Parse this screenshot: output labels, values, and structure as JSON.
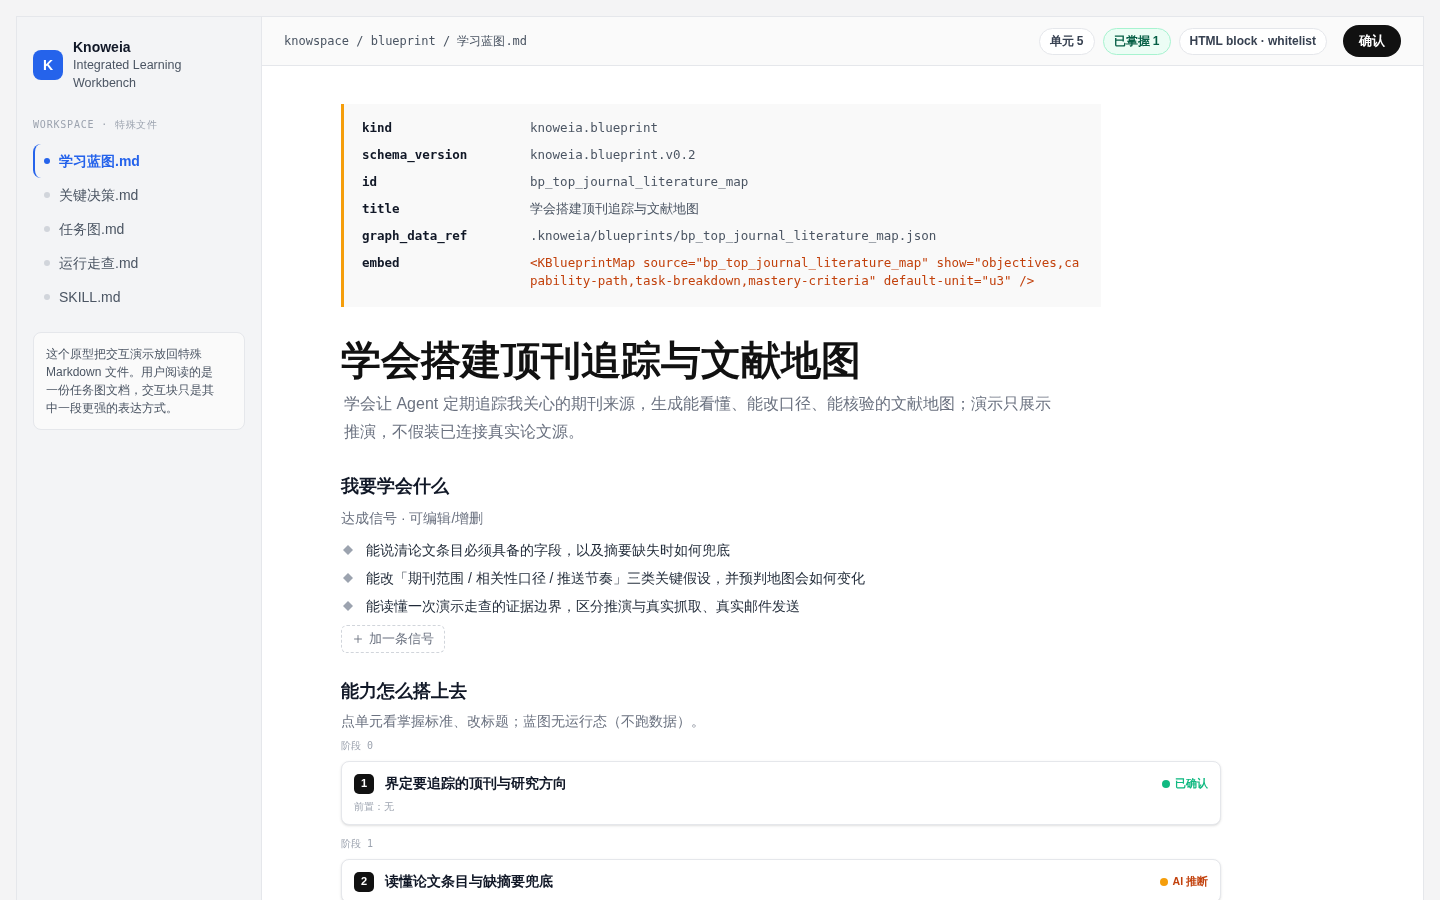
{
  "sidebar": {
    "brand": {
      "logo_letter": "K",
      "name": "Knoweia",
      "tagline": "Integrated Learning Workbench"
    },
    "section_label": "WORKSPACE · 特殊文件",
    "items": [
      {
        "label": "学习蓝图.md",
        "selected": true
      },
      {
        "label": "关键决策.md",
        "selected": false
      },
      {
        "label": "任务图.md",
        "selected": false
      },
      {
        "label": "运行走查.md",
        "selected": false
      },
      {
        "label": "SKILL.md",
        "selected": false
      }
    ],
    "note": "这个原型把交互演示放回特殊 Markdown 文件。用户阅读的是一份任务图文档，交互块只是其中一段更强的表达方式。"
  },
  "header": {
    "breadcrumb": "knowspace / blueprint / 学习蓝图.md",
    "badges": [
      {
        "label": "单元 5",
        "kind": "neutral"
      },
      {
        "label": "已掌握 1",
        "kind": "success"
      },
      {
        "label": "HTML block · whitelist",
        "kind": "neutral"
      }
    ],
    "confirm_button": "确认"
  },
  "frontmatter": {
    "fields": [
      {
        "key": "kind",
        "value": "knoweia.blueprint",
        "kind": "plain"
      },
      {
        "key": "schema_version",
        "value": "knoweia.blueprint.v0.2",
        "kind": "plain"
      },
      {
        "key": "id",
        "value": "bp_top_journal_literature_map",
        "kind": "plain"
      },
      {
        "key": "title",
        "value": "学会搭建顶刊追踪与文献地图",
        "kind": "plain"
      },
      {
        "key": "graph_data_ref",
        "value": ".knoweia/blueprints/bp_top_journal_literature_map.json",
        "kind": "plain"
      },
      {
        "key": "embed",
        "value": "<KBlueprintMap source=\"bp_top_journal_literature_map\" show=\"objectives,capability-path,task-breakdown,mastery-criteria\" default-unit=\"u3\" />",
        "kind": "code"
      }
    ]
  },
  "document": {
    "title": "学会搭建顶刊追踪与文献地图",
    "subtitle": "学会让 Agent 定期追踪我关心的期刊来源，生成能看懂、能改口径、能核验的文献地图；演示只展示推演，不假装已连接真实论文源。",
    "objectives": {
      "heading": "我要学会什么",
      "caption": "达成信号 · 可编辑/增删",
      "signals": [
        "能说清论文条目必须具备的字段，以及摘要缺失时如何兜底",
        "能改「期刊范围 / 相关性口径 / 推送节奏」三类关键假设，并预判地图会如何变化",
        "能读懂一次演示走查的证据边界，区分推演与真实抓取、真实邮件发送"
      ],
      "add_button": "加一条信号"
    },
    "capability_path": {
      "heading": "能力怎么搭上去",
      "caption": "点单元看掌握标准、改标题；蓝图无运行态（不跑数据）。",
      "stages": [
        {
          "label": "阶段 0",
          "units": [
            {
              "number": "1",
              "title": "界定要追踪的顶刊与研究方向",
              "status": {
                "label": "已确认",
                "kind": "confirmed",
                "color": "#10b981"
              },
              "prerequisite": "前置：无"
            }
          ]
        },
        {
          "label": "阶段 1",
          "units": [
            {
              "number": "2",
              "title": "读懂论文条目与缺摘要兜底",
              "status": {
                "label": "AI 推断",
                "kind": "inferred",
                "color": "#f59e0b"
              }
            }
          ]
        }
      ]
    }
  }
}
